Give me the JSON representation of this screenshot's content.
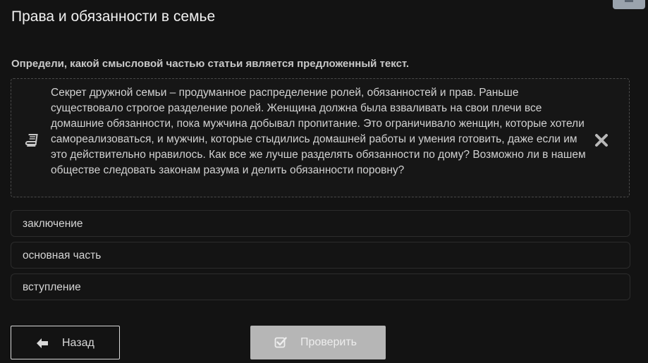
{
  "header": {
    "title": "Права и обязанности в семье"
  },
  "task": {
    "question": "Определи, какой смысловой частью статьи является предложенный текст.",
    "passage": "Секрет дружной семьи – продуманное распределение ролей, обязанностей и прав. Раньше существовало строгое разделение ролей. Женщина должна была взваливать на свои плечи все домашние обязанности, пока мужчина добывал пропитание. Это ограничивало женщин, которые хотели самореализоваться, и мужчин, которые стыдились домашней работы и умения готовить, даже если им это действительно нравилось. Как все же лучше разделять обязанности по дому? Возможно ли в нашем обществе следовать законам разума и делить обязанности поровну?",
    "passage_icon": "book-icon",
    "dismiss_icon": "close-icon"
  },
  "options": [
    {
      "label": "заключение"
    },
    {
      "label": "основная часть"
    },
    {
      "label": "вступление"
    }
  ],
  "footer": {
    "back_label": "Назад",
    "back_icon": "arrow-left-icon",
    "check_label": "Проверить",
    "check_icon": "checkbox-icon"
  },
  "colors": {
    "background": "#131313",
    "check_button": "#b6b6b6",
    "border": "#2c2c2c"
  }
}
